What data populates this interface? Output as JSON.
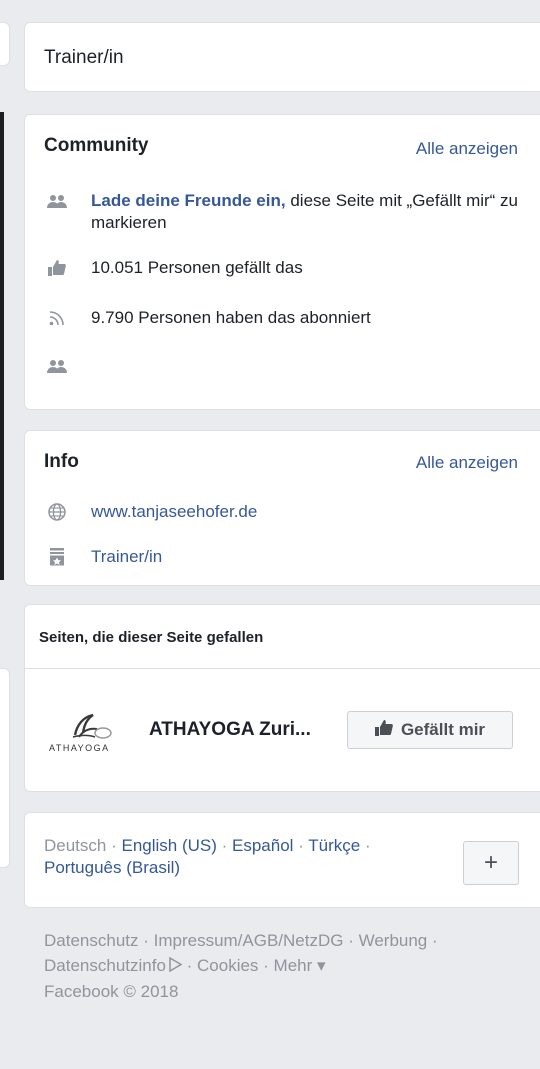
{
  "title_card": {
    "text": "Trainer/in"
  },
  "community": {
    "heading": "Community",
    "see_all": "Alle anzeigen",
    "invite_link": "Lade deine Freunde ein,",
    "invite_rest": " diese Seite mit „Gefällt mir“ zu markieren",
    "likes": "10.051 Personen gefällt das",
    "followers": "9.790 Personen haben das abonniert",
    "icons": [
      "friends-icon",
      "thumbs-up-icon",
      "rss-icon",
      "friends-icon"
    ]
  },
  "info": {
    "heading": "Info",
    "see_all": "Alle anzeigen",
    "website": "www.tanjaseehofer.de",
    "category": "Trainer/in"
  },
  "liked_pages": {
    "heading": "Seiten, die dieser Seite gefallen",
    "page_name": "ATHAYOGA Zuri...",
    "logo_text": "ATHAYOGA",
    "like_button": "Gefällt mir"
  },
  "languages": {
    "current": "Deutsch",
    "sep": " · ",
    "options": [
      "English (US)",
      "Español",
      "Türkçe",
      "Português (Brasil)"
    ],
    "plus": "+"
  },
  "footer": {
    "links": [
      "Datenschutz",
      "Impressum/AGB/NetzDG",
      "Werbung",
      "Datenschutzinfo",
      "Cookies",
      "Mehr"
    ],
    "more_arrow": "▾",
    "copyright": "Facebook © 2018"
  },
  "colors": {
    "link": "#365899",
    "muted": "#90949c",
    "background": "#e9ebee"
  }
}
